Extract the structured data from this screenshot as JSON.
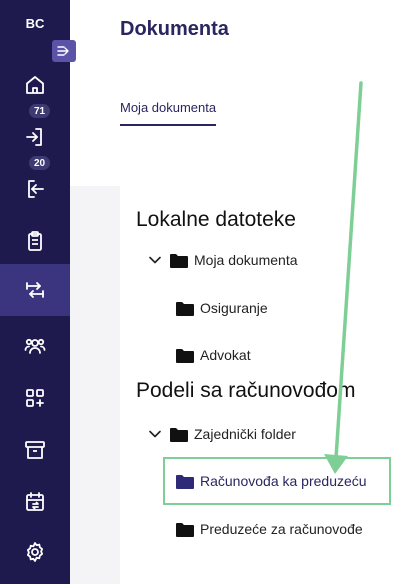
{
  "brand": {
    "initials": "BC"
  },
  "sidebar": {
    "items": [
      {
        "id": "home",
        "icon": "home-icon"
      },
      {
        "id": "inbox",
        "icon": "login-arrow-icon",
        "badge": "71"
      },
      {
        "id": "outbox",
        "icon": "logout-arrow-icon",
        "badge": "20"
      },
      {
        "id": "tasks",
        "icon": "clipboard-icon"
      },
      {
        "id": "documents",
        "icon": "exchange-icon",
        "active": true
      },
      {
        "id": "contacts",
        "icon": "users-icon"
      },
      {
        "id": "apps",
        "icon": "grid-plus-icon"
      },
      {
        "id": "archive",
        "icon": "archive-icon"
      },
      {
        "id": "calendar",
        "icon": "calendar-sync-icon"
      },
      {
        "id": "settings",
        "icon": "gear-icon"
      }
    ]
  },
  "header": {
    "title": "Dokumenta"
  },
  "tabs": [
    {
      "label": "Moja dokumenta",
      "active": true
    }
  ],
  "tree": {
    "local_title": "Lokalne datoteke",
    "local": {
      "root": "Moja dokumenta",
      "children": [
        "Osiguranje",
        "Advokat"
      ]
    },
    "shared_title": "Podeli sa računovođom",
    "shared": {
      "root": "Zajednički folder",
      "children": [
        "Računovođa ka preduzeću",
        "Preduzeće za računovođe"
      ]
    }
  },
  "colors": {
    "sidebar": "#1f1a4e",
    "sidebar_active": "#3b3580",
    "accent": "#2a2660",
    "selected_folder": "#2f2a78",
    "annotation_green": "#7ecf96"
  }
}
